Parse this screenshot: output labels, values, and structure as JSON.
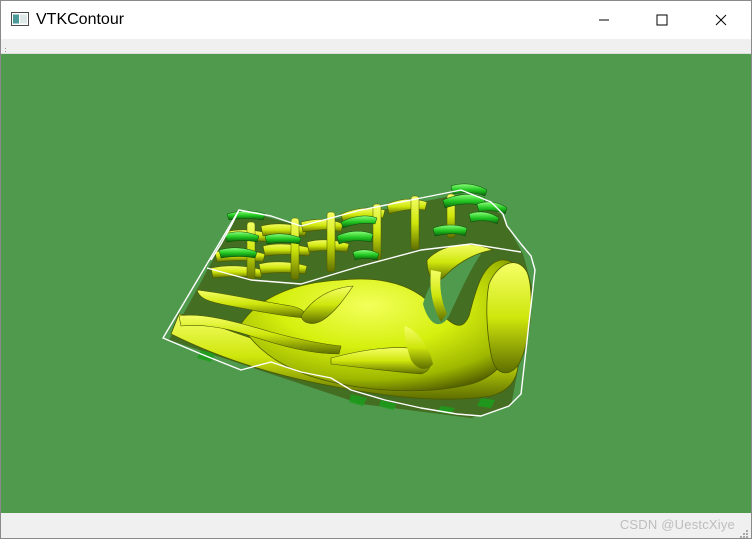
{
  "window": {
    "title": "VTKContour",
    "app_icon": "window-app-icon",
    "controls": {
      "minimize_icon": "minimize-icon",
      "maximize_icon": "maximize-icon",
      "close_icon": "close-icon"
    }
  },
  "render_view": {
    "background_color": "#4f9a4d",
    "surface_colors": {
      "highlight": "#e8ff2a",
      "base": "#c8e60c",
      "shadow": "#556600",
      "accent_green": "#1fc41f"
    },
    "outline_color": "#ffffff"
  },
  "watermark": {
    "text": "CSDN @UestcXiye"
  }
}
